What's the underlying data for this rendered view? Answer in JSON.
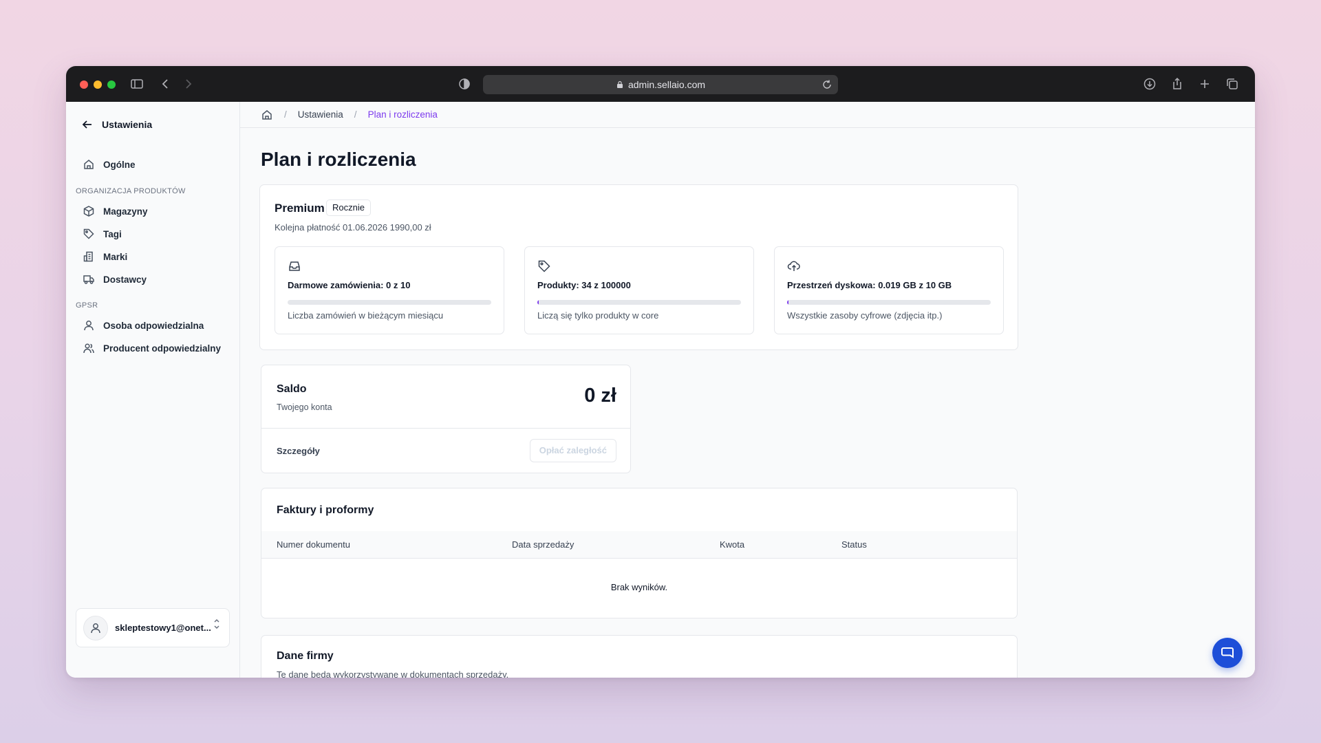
{
  "browser": {
    "url": "admin.sellaio.com"
  },
  "sidebar": {
    "back_label": "Ustawienia",
    "general": "Ogólne",
    "section_products": "ORGANIZACJA PRODUKTÓW",
    "products_items": [
      "Magazyny",
      "Tagi",
      "Marki",
      "Dostawcy"
    ],
    "section_gpsr": "GPSR",
    "gpsr_items": [
      "Osoba odpowiedzialna",
      "Producent odpowiedzialny"
    ],
    "user_email": "skleptestowy1@onet..."
  },
  "breadcrumb": {
    "items": [
      "Ustawienia",
      "Plan i rozliczenia"
    ]
  },
  "page": {
    "title": "Plan i rozliczenia"
  },
  "plan": {
    "name": "Premium",
    "billing": "Rocznie",
    "next_payment": "Kolejna płatność 01.06.2026 1990,00 zł",
    "usage": [
      {
        "icon": "inbox-icon",
        "title": "Darmowe zamówienia: 0 z 10",
        "fraction": 0,
        "desc": "Liczba zamówień w bieżącym miesiącu"
      },
      {
        "icon": "tag-icon",
        "title": "Produkty: 34 z 100000",
        "fraction": 0.00034,
        "desc": "Liczą się tylko produkty w core"
      },
      {
        "icon": "cloud-upload-icon",
        "title": "Przestrzeń dyskowa: 0.019 GB z 10 GB",
        "fraction": 0.0019,
        "desc": "Wszystkie zasoby cyfrowe (zdjęcia itp.)"
      }
    ]
  },
  "balance": {
    "title": "Saldo",
    "subtitle": "Twojego konta",
    "amount": "0 zł",
    "details": "Szczegóły",
    "pay_button": "Opłać zaległość"
  },
  "invoices": {
    "title": "Faktury i proformy",
    "columns": [
      "Numer dokumentu",
      "Data sprzedaży",
      "Kwota",
      "Status"
    ],
    "empty": "Brak wyników."
  },
  "company": {
    "title": "Dane firmy",
    "subtitle": "Te dane będą wykorzystywane w dokumentach sprzedaży."
  },
  "colors": {
    "accent": "#7c3aed",
    "chat": "#1d4ed8",
    "titlebar": "#1c1c1e"
  }
}
